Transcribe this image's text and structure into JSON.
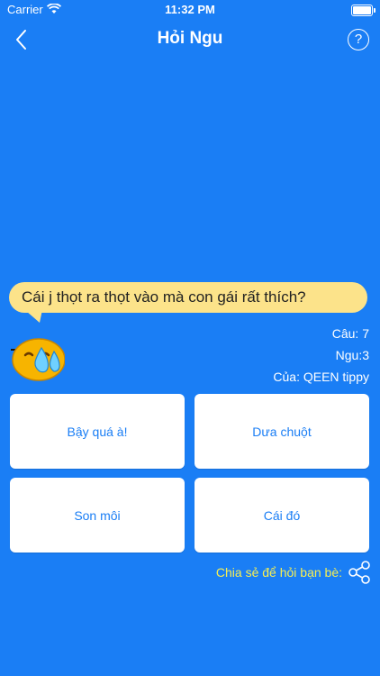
{
  "status": {
    "carrier": "Carrier",
    "time": "11:32 PM"
  },
  "nav": {
    "title": "Hỏi Ngu",
    "help_label": "?"
  },
  "question": {
    "text": "Cái j thọt ra thọt vào mà con gái rất thích?"
  },
  "meta": {
    "question_no": "Câu: 7",
    "dumb": "Ngu:3",
    "author": "Của: QEEN tippy"
  },
  "answers": [
    "Bậy quá à!",
    "Dưa chuột",
    "Son môi",
    "Cái đó"
  ],
  "share": {
    "label": "Chia sẻ để hỏi bạn bè:"
  },
  "colors": {
    "background": "#1a7ef5",
    "bubble": "#fce38a",
    "accent_text": "#f6ef53",
    "button_text": "#1a7ef5"
  }
}
